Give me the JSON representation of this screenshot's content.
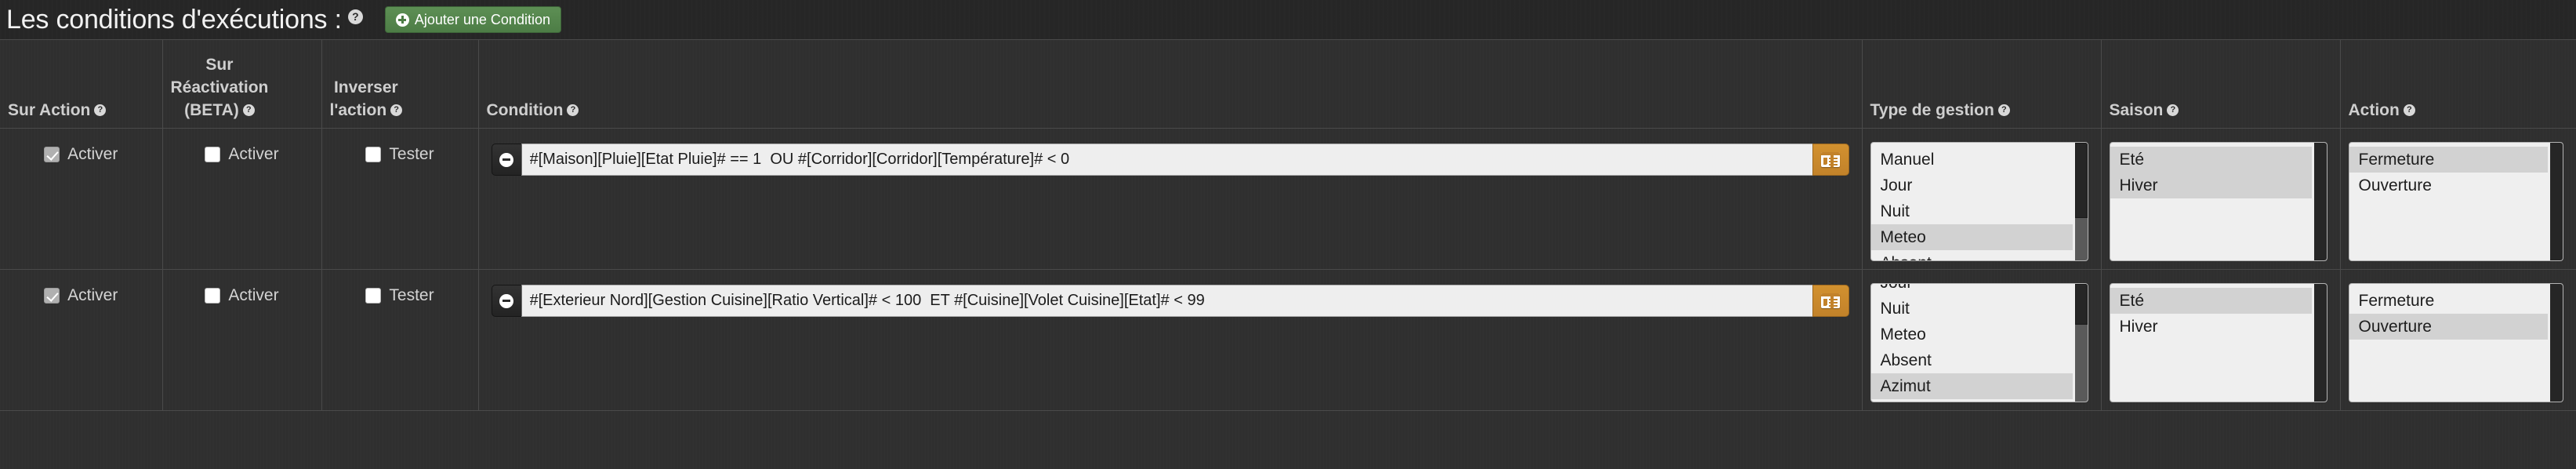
{
  "header": {
    "title": "Les conditions d'exécutions :",
    "help_icon": "help-icon",
    "add_button_label": "Ajouter une Condition",
    "add_button_icon": "plus-circle-icon",
    "accent_green": "#4d7d46"
  },
  "columns": [
    {
      "label": "Sur Action",
      "help": "?"
    },
    {
      "label": "Sur Réactivation (BETA)",
      "label_line1": "Sur",
      "label_line2": "Réactivation",
      "label_line3": "(BETA)",
      "help": "?"
    },
    {
      "label": "Inverser l'action",
      "label_line1": "Inverser",
      "label_line2": "l'action",
      "help": "?"
    },
    {
      "label": "Condition",
      "help": "?"
    },
    {
      "label": "Type de gestion",
      "help": "?"
    },
    {
      "label": "Saison",
      "help": "?"
    },
    {
      "label": "Action",
      "help": "?"
    }
  ],
  "rows": [
    {
      "sur_action": {
        "label": "Activer",
        "checked": true
      },
      "sur_reactivation": {
        "label": "Activer",
        "checked": false
      },
      "inverser": {
        "label": "Tester",
        "checked": false
      },
      "condition": {
        "value": "#[Maison][Pluie][Etat Pluie]# == 1  OU #[Corridor][Corridor][Température]# < 0",
        "placeholder": "",
        "remove_icon": "minus-circle-icon",
        "picker_icon": "list-icon"
      },
      "type_gestion": {
        "options": [
          "Manuel",
          "Jour",
          "Nuit",
          "Meteo",
          "Absent"
        ],
        "selected": [
          "Meteo"
        ],
        "scrolled": false
      },
      "saison": {
        "options": [
          "Eté",
          "Hiver"
        ],
        "selected": [
          "Eté",
          "Hiver"
        ],
        "scrolled": false
      },
      "action": {
        "options": [
          "Fermeture",
          "Ouverture"
        ],
        "selected": [
          "Fermeture"
        ],
        "scrolled": false
      }
    },
    {
      "sur_action": {
        "label": "Activer",
        "checked": true
      },
      "sur_reactivation": {
        "label": "Activer",
        "checked": false
      },
      "inverser": {
        "label": "Tester",
        "checked": false
      },
      "condition": {
        "value": "#[Exterieur Nord][Gestion Cuisine][Ratio Vertical]# < 100  ET #[Cuisine][Volet Cuisine][Etat]# < 99",
        "placeholder": "",
        "remove_icon": "minus-circle-icon",
        "picker_icon": "list-icon"
      },
      "type_gestion": {
        "options": [
          "Jour",
          "Nuit",
          "Meteo",
          "Absent",
          "Azimut"
        ],
        "selected": [
          "Azimut"
        ],
        "scrolled": true
      },
      "saison": {
        "options": [
          "Eté",
          "Hiver"
        ],
        "selected": [
          "Eté"
        ],
        "scrolled": false
      },
      "action": {
        "options": [
          "Fermeture",
          "Ouverture"
        ],
        "selected": [
          "Ouverture"
        ],
        "scrolled": false
      }
    }
  ],
  "colors": {
    "background": "#2f2f2f",
    "header_bar": "#262626",
    "border": "#4a4a4a",
    "text": "#d4d4d4",
    "accent_orange": "#c2822a",
    "accent_green": "#4d7d46",
    "field_bg": "#eeeeee",
    "selected_bg": "#d2d2d2"
  }
}
